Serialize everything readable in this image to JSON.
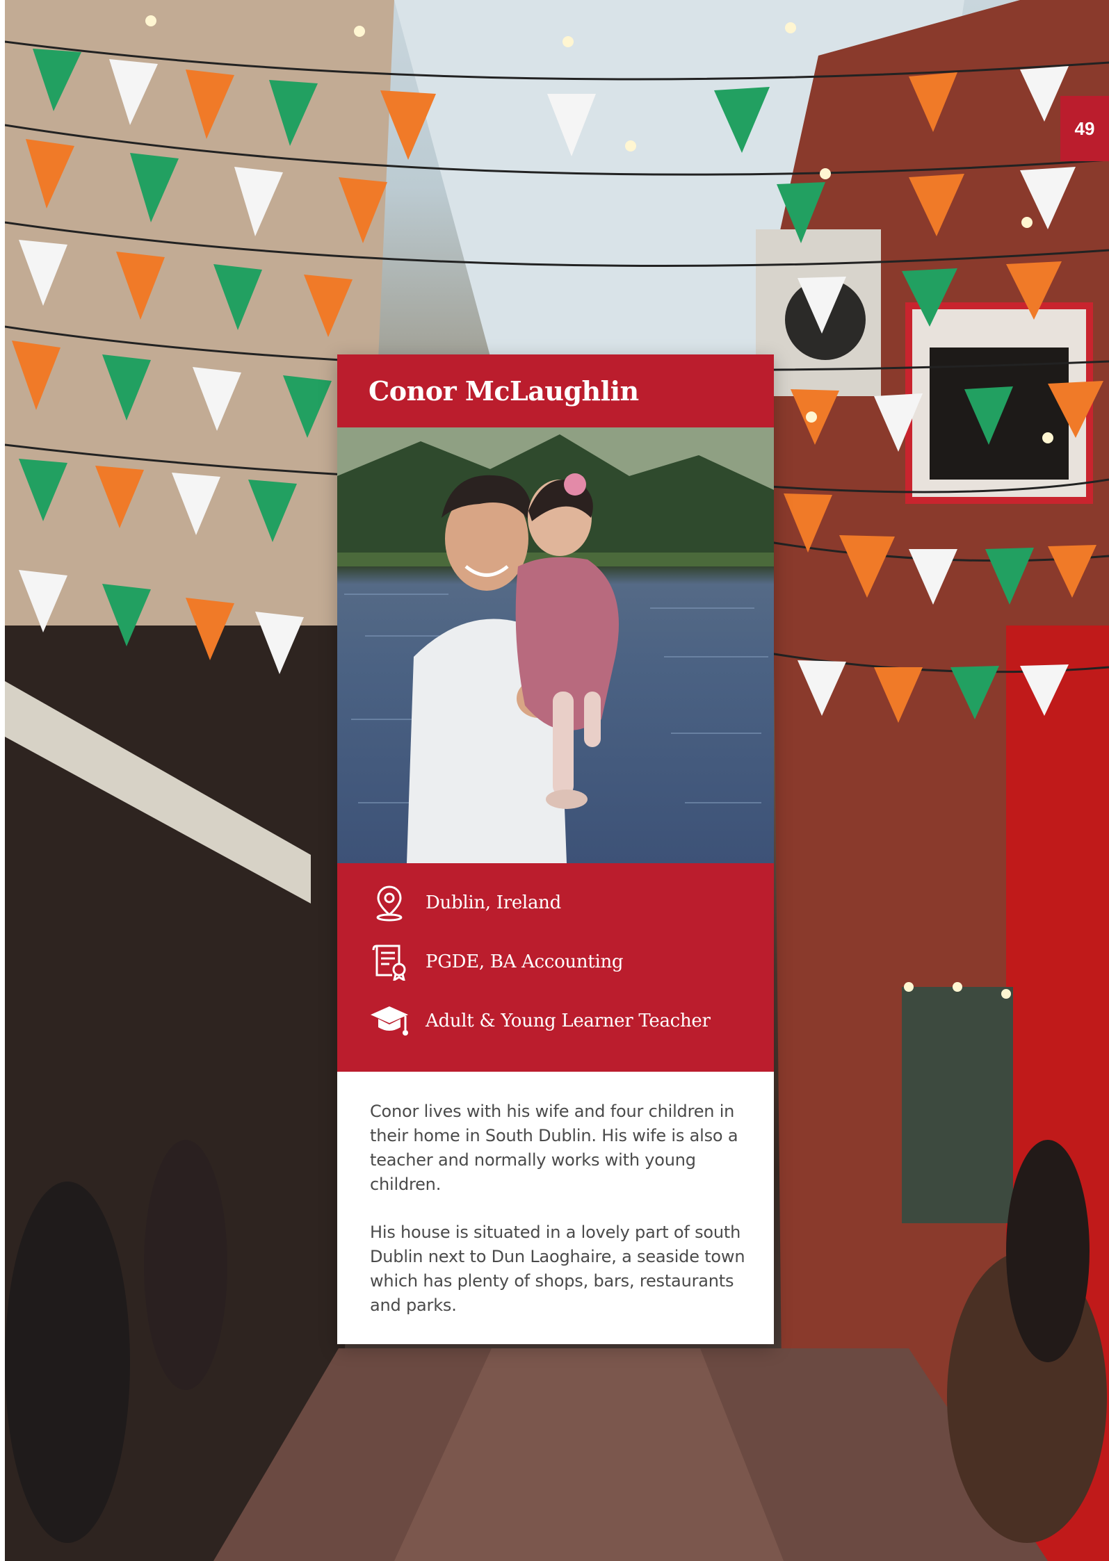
{
  "page": {
    "number": "49"
  },
  "profile": {
    "name": "Conor McLaughlin",
    "details": [
      {
        "icon": "location-pin-icon",
        "text": "Dublin, Ireland"
      },
      {
        "icon": "certificate-icon",
        "text": "PGDE, BA Accounting"
      },
      {
        "icon": "graduation-cap-icon",
        "text": "Adult & Young Learner Teacher"
      }
    ],
    "bio": [
      "Conor lives with his wife and four children in their home in South Dublin. His wife is also a teacher and normally works with young children.",
      "His house is situated in a lovely part of south Dublin next to Dun Laoghaire, a seaside town which has plenty of shops, bars, restaurants and parks."
    ]
  },
  "colors": {
    "accent": "#bb1d2d",
    "card_text": "#ffffff",
    "bio_text": "#4a4a4a"
  }
}
